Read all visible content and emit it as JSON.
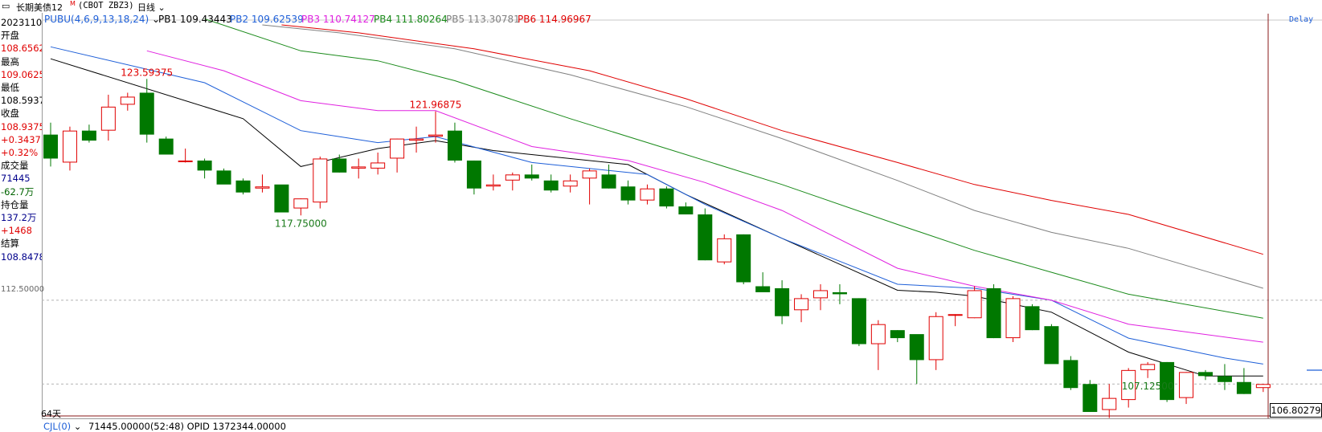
{
  "titlebar": {
    "name": "长期美债12",
    "name_suffix": "M",
    "code": "(CBOT ZBZ3)",
    "period": "日线"
  },
  "info_panel": [
    {
      "text": "20231101",
      "color": "#000000"
    },
    {
      "text": "开盘",
      "color": "#000000"
    },
    {
      "text": "108.6562",
      "color": "#e00000"
    },
    {
      "text": "最高",
      "color": "#000000"
    },
    {
      "text": "109.0625",
      "color": "#e00000"
    },
    {
      "text": "最低",
      "color": "#000000"
    },
    {
      "text": "108.5937",
      "color": "#000000"
    },
    {
      "text": "收盘",
      "color": "#000000"
    },
    {
      "text": "108.9375",
      "color": "#e00000"
    },
    {
      "text": "+0.3437",
      "color": "#e00000"
    },
    {
      "text": "+0.32%",
      "color": "#e00000"
    },
    {
      "text": "成交量",
      "color": "#000000"
    },
    {
      "text": "71445",
      "color": "#00008b"
    },
    {
      "text": "-62.7万",
      "color": "#006400"
    },
    {
      "text": "持仓量",
      "color": "#000000"
    },
    {
      "text": "137.2万",
      "color": "#00008b"
    },
    {
      "text": "+1468",
      "color": "#e00000"
    },
    {
      "text": "结算",
      "color": "#000000"
    },
    {
      "text": "108.8478",
      "color": "#00008b"
    }
  ],
  "legend": {
    "indicator": "PUBU(4,6,9,13,18,24)",
    "items": [
      {
        "label": "PB1 109.43443",
        "color": "#000000"
      },
      {
        "label": "PB2 109.62539",
        "color": "#1e5fd8"
      },
      {
        "label": "PB3 110.74127",
        "color": "#e020e0"
      },
      {
        "label": "PB4 111.80264",
        "color": "#1a8a1a"
      },
      {
        "label": "PB5 113.30781",
        "color": "#808080"
      },
      {
        "label": "PB6 114.96967",
        "color": "#e00000"
      }
    ]
  },
  "delay_label": "Delay",
  "day_count_label": "64天",
  "grid_label": "112.50000",
  "current_price": "106.80279",
  "bottom_bar": {
    "indicator": "CJL(0)",
    "text": "71445.00000(52:48)  OPID 1372344.00000"
  },
  "chart_data": {
    "type": "candlestick",
    "title": "长期美债12M (CBOT ZBZ3) 日线",
    "y_ref": 112.5,
    "annotations": [
      {
        "text": "123.59375",
        "candle": 5,
        "pos": "above",
        "color": "#e00000"
      },
      {
        "text": "121.96875",
        "candle": 20,
        "pos": "above",
        "color": "#e00000"
      },
      {
        "text": "117.75000",
        "candle": 13,
        "pos": "below",
        "color": "#1a7a1a"
      },
      {
        "text": "107.12500",
        "candle": 57,
        "pos": "below",
        "color": "#1a7a1a"
      }
    ],
    "candles": [
      [
        120.8,
        121.4,
        119.2,
        119.6
      ],
      [
        119.4,
        121.2,
        119.0,
        121.0
      ],
      [
        121.0,
        121.3,
        120.4,
        120.5
      ],
      [
        121.0,
        122.8,
        120.5,
        122.2
      ],
      [
        122.3,
        122.9,
        122.0,
        122.7
      ],
      [
        122.9,
        123.59,
        120.4,
        120.8
      ],
      [
        120.6,
        120.7,
        119.8,
        119.8
      ],
      [
        119.5,
        120.1,
        119.4,
        119.5
      ],
      [
        119.5,
        119.6,
        118.6,
        119.0
      ],
      [
        119.0,
        119.1,
        118.5,
        118.3
      ],
      [
        118.5,
        118.6,
        117.8,
        117.9
      ],
      [
        118.1,
        118.8,
        117.9,
        118.2
      ],
      [
        118.3,
        118.1,
        117.6,
        116.9
      ],
      [
        117.1,
        117.6,
        116.75,
        117.6
      ],
      [
        117.4,
        119.7,
        117.1,
        119.6
      ],
      [
        119.6,
        119.8,
        118.9,
        118.9
      ],
      [
        119.1,
        119.6,
        118.6,
        119.2
      ],
      [
        119.1,
        119.9,
        118.8,
        119.4
      ],
      [
        119.6,
        120.6,
        118.9,
        120.6
      ],
      [
        120.5,
        121.2,
        119.9,
        120.6
      ],
      [
        120.7,
        121.97,
        120.4,
        120.8
      ],
      [
        121.0,
        121.4,
        119.4,
        119.5
      ],
      [
        119.5,
        119.5,
        117.8,
        118.1
      ],
      [
        118.2,
        118.8,
        118.0,
        118.3
      ],
      [
        118.5,
        118.9,
        118.0,
        118.8
      ],
      [
        118.8,
        119.3,
        118.5,
        118.6
      ],
      [
        118.5,
        118.8,
        117.9,
        118.0
      ],
      [
        118.2,
        118.8,
        117.9,
        118.5
      ],
      [
        118.6,
        119.1,
        117.3,
        119.0
      ],
      [
        118.8,
        119.3,
        118.1,
        118.1
      ],
      [
        118.2,
        118.5,
        117.3,
        117.5
      ],
      [
        117.5,
        118.3,
        117.3,
        118.1
      ],
      [
        118.1,
        118.2,
        117.1,
        117.2
      ],
      [
        117.2,
        117.4,
        116.8,
        116.8
      ],
      [
        116.8,
        117.1,
        114.5,
        114.5
      ],
      [
        114.4,
        115.8,
        114.3,
        115.6
      ],
      [
        115.8,
        115.8,
        113.3,
        113.4
      ],
      [
        113.2,
        113.9,
        113.0,
        112.9
      ],
      [
        113.1,
        113.5,
        111.3,
        111.7
      ],
      [
        112.0,
        112.8,
        111.4,
        112.6
      ],
      [
        112.6,
        113.3,
        112.0,
        113.0
      ],
      [
        112.9,
        113.3,
        112.3,
        112.8
      ],
      [
        112.6,
        112.6,
        110.2,
        110.3
      ],
      [
        110.3,
        111.5,
        109.0,
        111.3
      ],
      [
        111.0,
        111.0,
        110.4,
        110.6
      ],
      [
        110.8,
        110.4,
        108.3,
        109.5
      ],
      [
        109.5,
        111.9,
        109.0,
        111.7
      ],
      [
        111.8,
        111.8,
        111.2,
        111.8
      ],
      [
        111.6,
        113.2,
        111.6,
        113.0
      ],
      [
        113.1,
        113.3,
        110.6,
        110.6
      ],
      [
        110.6,
        112.7,
        110.4,
        112.6
      ],
      [
        112.2,
        112.3,
        111.0,
        111.0
      ],
      [
        111.2,
        111.3,
        109.5,
        109.3
      ],
      [
        109.5,
        109.7,
        108.0,
        108.1
      ],
      [
        108.3,
        108.5,
        106.9,
        106.9
      ],
      [
        107.0,
        108.3,
        106.6,
        107.6
      ],
      [
        107.5,
        109.1,
        107.12,
        109.0
      ],
      [
        109.0,
        109.4,
        108.6,
        109.3
      ],
      [
        109.4,
        109.4,
        107.4,
        107.5
      ],
      [
        107.6,
        108.9,
        107.3,
        108.9
      ],
      [
        108.9,
        109.0,
        108.5,
        108.7
      ],
      [
        108.7,
        109.3,
        108.0,
        108.4
      ],
      [
        108.4,
        109.1,
        107.8,
        107.8
      ],
      [
        108.1,
        108.3,
        107.9,
        108.3
      ]
    ],
    "pb_lines": [
      {
        "name": "PB1",
        "color": "#000000",
        "points": [
          [
            0,
            124.6
          ],
          [
            10,
            121.6
          ],
          [
            13,
            119.2
          ],
          [
            17,
            120.1
          ],
          [
            20,
            120.5
          ],
          [
            23,
            120.0
          ],
          [
            30,
            119.3
          ],
          [
            33,
            117.8
          ],
          [
            38,
            115.6
          ],
          [
            44,
            113.0
          ],
          [
            46,
            112.9
          ],
          [
            48,
            112.7
          ],
          [
            52,
            111.9
          ],
          [
            56,
            109.9
          ],
          [
            60,
            108.7
          ],
          [
            63,
            108.7
          ]
        ]
      },
      {
        "name": "PB2",
        "color": "#1e5fd8",
        "points": [
          [
            0,
            125.2
          ],
          [
            8,
            123.4
          ],
          [
            13,
            121.0
          ],
          [
            17,
            120.4
          ],
          [
            20,
            120.7
          ],
          [
            25,
            119.4
          ],
          [
            31,
            118.8
          ],
          [
            34,
            117.3
          ],
          [
            38,
            115.6
          ],
          [
            44,
            113.3
          ],
          [
            48,
            113.1
          ],
          [
            52,
            112.5
          ],
          [
            56,
            110.6
          ],
          [
            61,
            109.6
          ],
          [
            63,
            109.3
          ]
        ]
      },
      {
        "name": "PB3",
        "color": "#e020e0",
        "points": [
          [
            5,
            125.0
          ],
          [
            9,
            124.0
          ],
          [
            13,
            122.5
          ],
          [
            17,
            122.0
          ],
          [
            20,
            122.0
          ],
          [
            25,
            120.2
          ],
          [
            30,
            119.5
          ],
          [
            34,
            118.4
          ],
          [
            38,
            117.0
          ],
          [
            44,
            114.1
          ],
          [
            48,
            113.2
          ],
          [
            52,
            112.5
          ],
          [
            56,
            111.3
          ],
          [
            63,
            110.4
          ]
        ]
      },
      {
        "name": "PB4",
        "color": "#1a8a1a",
        "points": [
          [
            8,
            126.6
          ],
          [
            13,
            125.0
          ],
          [
            17,
            124.5
          ],
          [
            21,
            123.5
          ],
          [
            27,
            121.6
          ],
          [
            32,
            120.1
          ],
          [
            38,
            118.3
          ],
          [
            44,
            116.3
          ],
          [
            48,
            115.0
          ],
          [
            52,
            113.9
          ],
          [
            56,
            112.8
          ],
          [
            63,
            111.6
          ]
        ]
      },
      {
        "name": "PB5",
        "color": "#808080",
        "points": [
          [
            11,
            126.3
          ],
          [
            15,
            125.9
          ],
          [
            21,
            125.1
          ],
          [
            27,
            123.8
          ],
          [
            33,
            122.2
          ],
          [
            38,
            120.6
          ],
          [
            44,
            118.5
          ],
          [
            48,
            117.0
          ],
          [
            52,
            115.9
          ],
          [
            56,
            115.1
          ],
          [
            63,
            113.1
          ]
        ]
      },
      {
        "name": "PB6",
        "color": "#e00000",
        "points": [
          [
            12,
            126.3
          ],
          [
            16,
            125.9
          ],
          [
            22,
            125.1
          ],
          [
            28,
            124.0
          ],
          [
            33,
            122.6
          ],
          [
            38,
            121.0
          ],
          [
            44,
            119.4
          ],
          [
            48,
            118.3
          ],
          [
            52,
            117.5
          ],
          [
            56,
            116.8
          ],
          [
            63,
            114.8
          ]
        ]
      }
    ]
  }
}
